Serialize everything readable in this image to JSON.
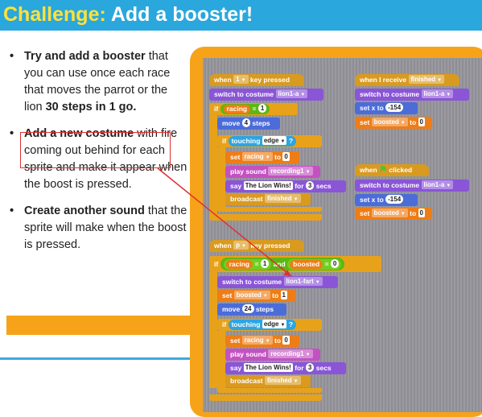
{
  "header": {
    "prefix": "Challenge:",
    "title": "Add a booster!"
  },
  "bullets": [
    {
      "bold1": "Try and add a booster",
      "text1": " that you can use once each race that moves the parrot or the lion ",
      "bold2": "30 steps in 1 go.",
      "text2": ""
    },
    {
      "bold1": "Add a new costume",
      "text1": " with fire coming out behind for each sprite and make it appear when the boost is pressed.",
      "bold2": "",
      "text2": ""
    },
    {
      "bold1": "Create another sound",
      "text1": " that the sprite will make when the boost is pressed.",
      "bold2": "",
      "text2": ""
    }
  ],
  "colors": {
    "title_bar": "#2aa7dc",
    "title_highlight": "#ffe23a",
    "panel_orange": "#f6a31a",
    "arrow": "#e03030"
  },
  "script1": {
    "hat": "when",
    "hat_key": "1",
    "hat_tail": "key pressed",
    "switch": "switch to costume",
    "switch_val": "lion1-a",
    "if_label": "if",
    "racing": "racing",
    "eq": "=",
    "eq_val": "1",
    "move": "move",
    "move_val": "4",
    "steps": "steps",
    "touching": "touching",
    "touching_val": "edge",
    "q": "?",
    "set": "set",
    "set_var": "racing",
    "to": "to",
    "set_val": "0",
    "play": "play sound",
    "sound_val": "recording1",
    "say": "say",
    "say_val": "The Lion Wins!",
    "for": "for",
    "say_secs": "3",
    "secs": "secs",
    "broadcast": "broadcast",
    "broadcast_val": "finished"
  },
  "script2": {
    "hat": "when I receive",
    "hat_val": "finished",
    "switch": "switch to costume",
    "switch_val": "lion1-a",
    "setx": "set x to",
    "setx_val": "-154",
    "set": "set",
    "set_var": "boosted",
    "to": "to",
    "set_val": "0"
  },
  "script3": {
    "hat": "when",
    "hat_tail": "clicked",
    "switch": "switch to costume",
    "switch_val": "lion1-a",
    "setx": "set x to",
    "setx_val": "-154",
    "set": "set",
    "set_var": "boosted",
    "to": "to",
    "set_val": "0"
  },
  "script4": {
    "hat": "when",
    "hat_key": "p",
    "hat_tail": "key pressed",
    "if_label": "if",
    "racing": "racing",
    "eq": "=",
    "eq_val": "1",
    "and": "and",
    "boosted": "boosted",
    "eq2": "=",
    "eq2_val": "0",
    "switch": "switch to costume",
    "switch_val": "lion1-fart",
    "set": "set",
    "set_var": "boosted",
    "to": "to",
    "set_val": "1",
    "move": "move",
    "move_val": "24",
    "steps": "steps",
    "touching": "touching",
    "touching_val": "edge",
    "q": "?",
    "set2": "set",
    "set2_var": "racing",
    "to2": "to",
    "set2_val": "0",
    "play": "play sound",
    "sound_val": "recording1",
    "say": "say",
    "say_val": "The Lion Wins!",
    "for": "for",
    "say_secs": "3",
    "secs": "secs",
    "broadcast": "broadcast",
    "broadcast_val": "finished"
  }
}
